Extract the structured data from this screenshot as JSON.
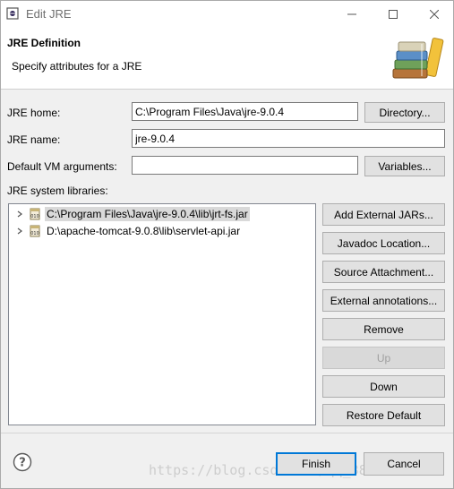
{
  "window": {
    "title": "Edit JRE",
    "icon": "eclipse-icon",
    "controls": [
      "minimize-icon",
      "maximize-icon",
      "close-icon"
    ]
  },
  "header": {
    "title": "JRE Definition",
    "subtitle": "Specify attributes for a JRE",
    "banner_icon": "books-icon"
  },
  "form": {
    "jre_home_label": "JRE home:",
    "jre_home_value": "C:\\Program Files\\Java\\jre-9.0.4",
    "directory_button": "Directory...",
    "jre_name_label": "JRE name:",
    "jre_name_value": "jre-9.0.4",
    "vm_args_label": "Default VM arguments:",
    "vm_args_value": "",
    "variables_button": "Variables...",
    "libraries_label": "JRE system libraries:"
  },
  "libraries": [
    {
      "label": "C:\\Program Files\\Java\\jre-9.0.4\\lib\\jrt-fs.jar",
      "selected": true,
      "icon": "jar-icon"
    },
    {
      "label": "D:\\apache-tomcat-9.0.8\\lib\\servlet-api.jar",
      "selected": false,
      "icon": "jar-icon"
    }
  ],
  "side_buttons": {
    "add_external_jars": "Add External JARs...",
    "javadoc_location": "Javadoc Location...",
    "source_attachment": "Source Attachment...",
    "external_annotations": "External annotations...",
    "remove": "Remove",
    "up": "Up",
    "down": "Down",
    "restore_default": "Restore Default"
  },
  "footer": {
    "help_icon": "help-icon",
    "finish_button": "Finish",
    "cancel_button": "Cancel",
    "watermark": "https://blog.csdn.net/qq_38489044"
  },
  "colors": {
    "accent": "#0078d7",
    "dialog_bg": "#f0f0f0",
    "button_bg": "#e1e1e1"
  }
}
